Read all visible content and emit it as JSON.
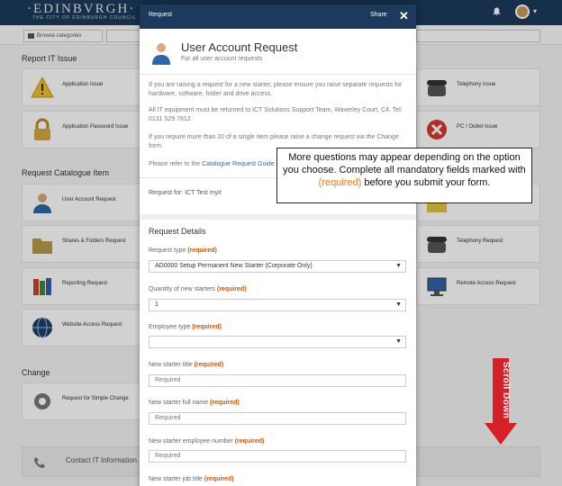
{
  "header": {
    "logo_text": "·EDINBVRGH·",
    "logo_sub": "THE CITY OF EDINBURGH COUNCIL"
  },
  "toolbar": {
    "browse_label": "Browse categories"
  },
  "background": {
    "section_report": "Report IT Issue",
    "section_catalogue": "Request Catalogue Item",
    "section_change": "Change",
    "tiles": {
      "app_issue": "Application Issue",
      "app_password": "Application Password Issue",
      "telephony_issue": "Telephony Issue",
      "pc_issue": "PC / Outlet Issue",
      "user_account": "User Account Request",
      "shares_folders": "Shares & Folders Request",
      "telephony_request": "Telephony Request",
      "reporting": "Reporting Request",
      "remote_access": "Remote Access Request",
      "website_access": "Website Access Request",
      "simple_change": "Request for Simple Change"
    },
    "contact_label": "Contact IT Information"
  },
  "modal": {
    "header_title": "Request",
    "share_label": "Share",
    "close_glyph": "✕",
    "title": "User Account Request",
    "subtitle": "For all user account requests",
    "para1": "If you are raising a request for a new starter, please ensure you raise separate requests for hardware, software, folder and drive access.",
    "para2": "All IT equipment must be returned to ICT Solutions Support Team, Waverley Court, C4, Tel: 0131 529 7812",
    "para3": "If you require more than 20 of a single item please raise a change request via the Change form.",
    "para4_prefix": "Please refer to the ",
    "para4_link": "Catalogue Request Guide",
    "request_for": "Request for: ICT Test myit",
    "details_title": "Request Details",
    "required_tag": "(required)",
    "fields": {
      "request_type_label": "Request type",
      "request_type_value": "AD0000 Setup Permanent New Starter (Corporate Only)",
      "quantity_label": "Quantity of new starters",
      "quantity_value": "1",
      "employee_type_label": "Employee type",
      "employee_type_value": "",
      "title_label": "New starter title",
      "title_placeholder": "Required",
      "full_name_label": "New starter full name",
      "full_name_placeholder": "Required",
      "employee_number_label": "New starter employee number",
      "employee_number_placeholder": "Required",
      "job_title_label": "New starter job title"
    }
  },
  "callout": {
    "text_before": "More questions may appear depending on the option you choose. Complete all mandatory fields marked with ",
    "text_required": "(required)",
    "text_after": " before you submit your form."
  },
  "scroll_hint": {
    "label": "Scroll Down",
    "color": "#d61f26"
  },
  "colors": {
    "header_bg": "#1b3a5c",
    "required": "#d35400",
    "link": "#2a6db0"
  }
}
